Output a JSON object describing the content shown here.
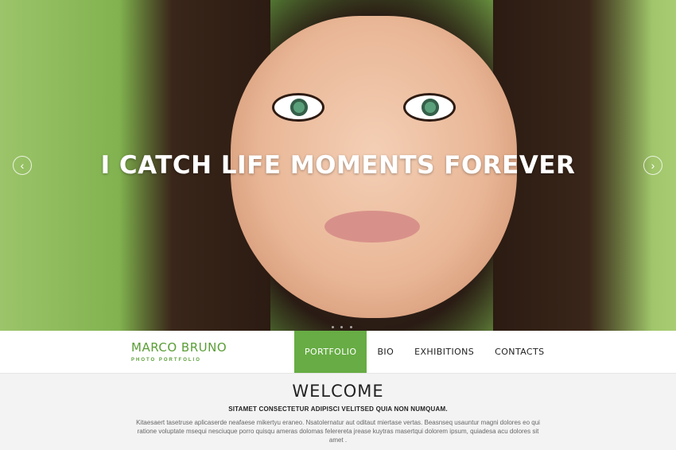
{
  "hero": {
    "title": "I CATCH LIFE MOMENTS FOREVER",
    "prev_icon": "chevron-left-icon",
    "next_icon": "chevron-right-icon",
    "prev_glyph": "‹",
    "next_glyph": "›"
  },
  "brand": {
    "name": "MARCO BRUNO",
    "tagline": "PHOTO PORTFOLIO"
  },
  "nav": {
    "items": [
      {
        "label": "PORTFOLIO",
        "active": true
      },
      {
        "label": "BIO",
        "active": false
      },
      {
        "label": "EXHIBITIONS",
        "active": false
      },
      {
        "label": "CONTACTS",
        "active": false
      }
    ]
  },
  "welcome": {
    "heading": "WELCOME",
    "subheading": "SITAMET CONSECTETUR ADIPISCI VELITSED QUIA NON NUMQUAM.",
    "body": "Kitaesaert tasetruse aplicaserde neafaese mikertyu eraneo. Nsatolernatur aut oditaut miertase vertas.  Beasnseq usauntur magni dolores eo qui ratione voluptate msequi nesciuque porro quisqu ameras dolomas felerereta jrease kuytras masertqui dolorem ipsum, quiadesa acu dolores sit amet ."
  },
  "colors": {
    "accent": "#67ac44",
    "brand": "#5a9e36"
  }
}
